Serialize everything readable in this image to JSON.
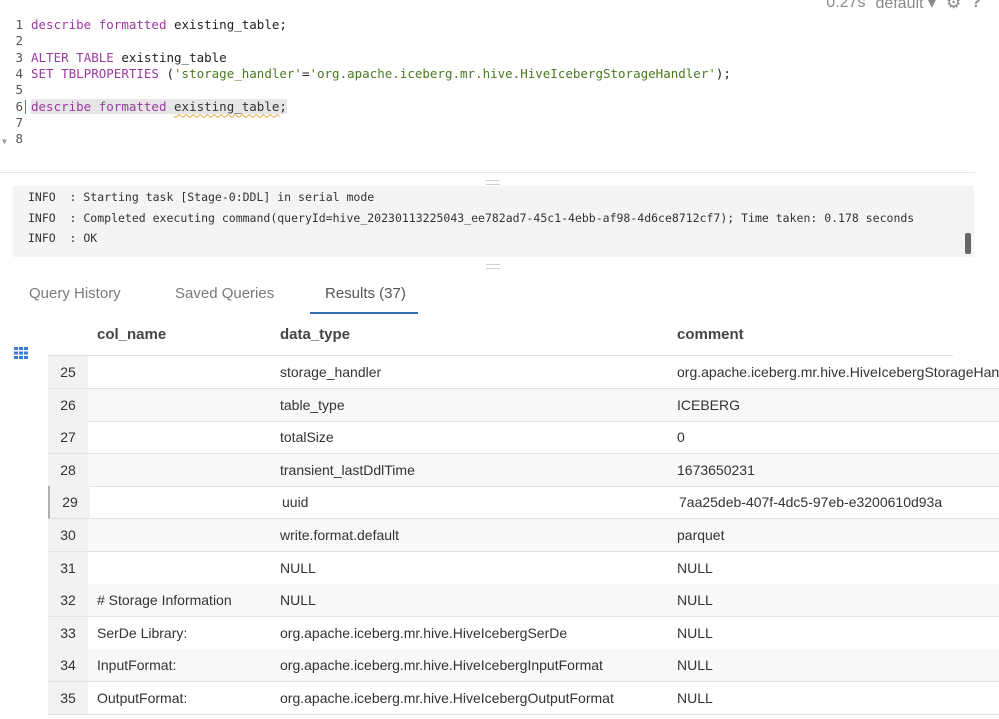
{
  "status": {
    "timing": "0.27s",
    "database": "default"
  },
  "editor": {
    "lines": [
      {
        "num": "1",
        "parts": [
          {
            "t": "describe",
            "c": "kw"
          },
          {
            "t": " "
          },
          {
            "t": "formatted",
            "c": "kw"
          },
          {
            "t": " existing_table;"
          }
        ]
      },
      {
        "num": "2",
        "parts": []
      },
      {
        "num": "3",
        "parts": [
          {
            "t": "ALTER",
            "c": "kw"
          },
          {
            "t": " "
          },
          {
            "t": "TABLE",
            "c": "kw"
          },
          {
            "t": " existing_table"
          }
        ]
      },
      {
        "num": "4",
        "parts": [
          {
            "t": "SET",
            "c": "kw"
          },
          {
            "t": " "
          },
          {
            "t": "TBLPROPERTIES",
            "c": "kw"
          },
          {
            "t": " ("
          },
          {
            "t": "'storage_handler'",
            "c": "str"
          },
          {
            "t": "="
          },
          {
            "t": "'org.apache.iceberg.mr.hive.HiveIcebergStorageHandler'",
            "c": "str"
          },
          {
            "t": ");"
          }
        ]
      },
      {
        "num": "5",
        "parts": []
      },
      {
        "num": "6",
        "parts": [
          {
            "t": "describe",
            "c": "kw hl"
          },
          {
            "t": " ",
            "c": "hl"
          },
          {
            "t": "formatted",
            "c": "kw hl"
          },
          {
            "t": " ",
            "c": "hl"
          },
          {
            "t": "existing_table",
            "c": "hl squig"
          },
          {
            "t": ";",
            "c": "hl"
          }
        ]
      },
      {
        "num": "7",
        "parts": []
      },
      {
        "num": "8",
        "parts": []
      }
    ]
  },
  "log": [
    "INFO  : Starting task [Stage-0:DDL] in serial mode",
    "INFO  : Completed executing command(queryId=hive_20230113225043_ee782ad7-45c1-4ebb-af98-4d6ce8712cf7); Time taken: 0.178 seconds",
    "INFO  : OK"
  ],
  "tabs": {
    "history": "Query History",
    "saved": "Saved Queries",
    "results": "Results (37)"
  },
  "table": {
    "headers": {
      "col_name": "col_name",
      "data_type": "data_type",
      "comment": "comment"
    },
    "rows": [
      {
        "idx": "25",
        "col": "",
        "type": "storage_handler",
        "comment": "org.apache.iceberg.mr.hive.HiveIcebergStorageHandler"
      },
      {
        "idx": "26",
        "col": "",
        "type": "table_type",
        "comment": "ICEBERG"
      },
      {
        "idx": "27",
        "col": "",
        "type": "totalSize",
        "comment": "0"
      },
      {
        "idx": "28",
        "col": "",
        "type": "transient_lastDdlTime",
        "comment": "1673650231"
      },
      {
        "idx": "29",
        "col": "",
        "type": "uuid",
        "comment": "7aa25deb-407f-4dc5-97eb-e3200610d93a"
      },
      {
        "idx": "30",
        "col": "",
        "type": "write.format.default",
        "comment": "parquet"
      },
      {
        "idx": "31",
        "col": "",
        "type": "NULL",
        "comment": "NULL"
      },
      {
        "idx": "32",
        "col": "# Storage Information",
        "type": "NULL",
        "comment": "NULL"
      },
      {
        "idx": "33",
        "col": "SerDe Library:",
        "type": "org.apache.iceberg.mr.hive.HiveIcebergSerDe",
        "comment": "NULL"
      },
      {
        "idx": "34",
        "col": "InputFormat:",
        "type": "org.apache.iceberg.mr.hive.HiveIcebergInputFormat",
        "comment": "NULL"
      },
      {
        "idx": "35",
        "col": "OutputFormat:",
        "type": "org.apache.iceberg.mr.hive.HiveIcebergOutputFormat",
        "comment": "NULL"
      }
    ]
  }
}
